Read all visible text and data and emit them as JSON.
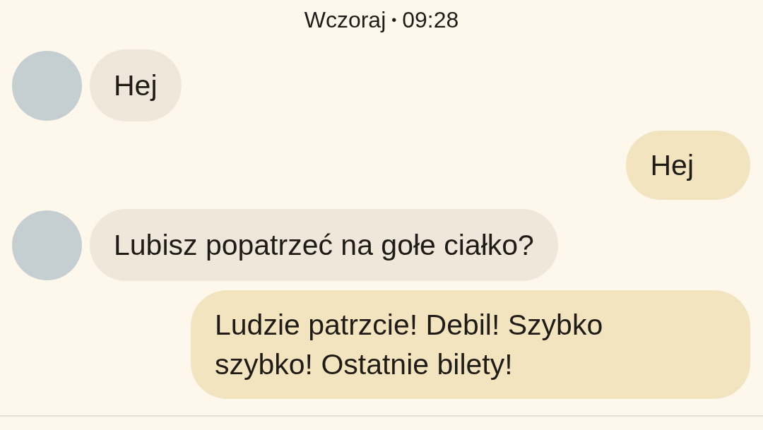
{
  "date_header": {
    "day": "Wczoraj",
    "separator": "•",
    "time": "09:28"
  },
  "messages": [
    {
      "kind": "incoming",
      "text": "Hej"
    },
    {
      "kind": "outgoing",
      "text": "Hej"
    },
    {
      "kind": "incoming",
      "text": "Lubisz popatrzeć na gołe ciałko?"
    },
    {
      "kind": "outgoing",
      "text": "Ludzie patrzcie! Debil! Szybko szybko! Ostatnie bilety!"
    }
  ]
}
